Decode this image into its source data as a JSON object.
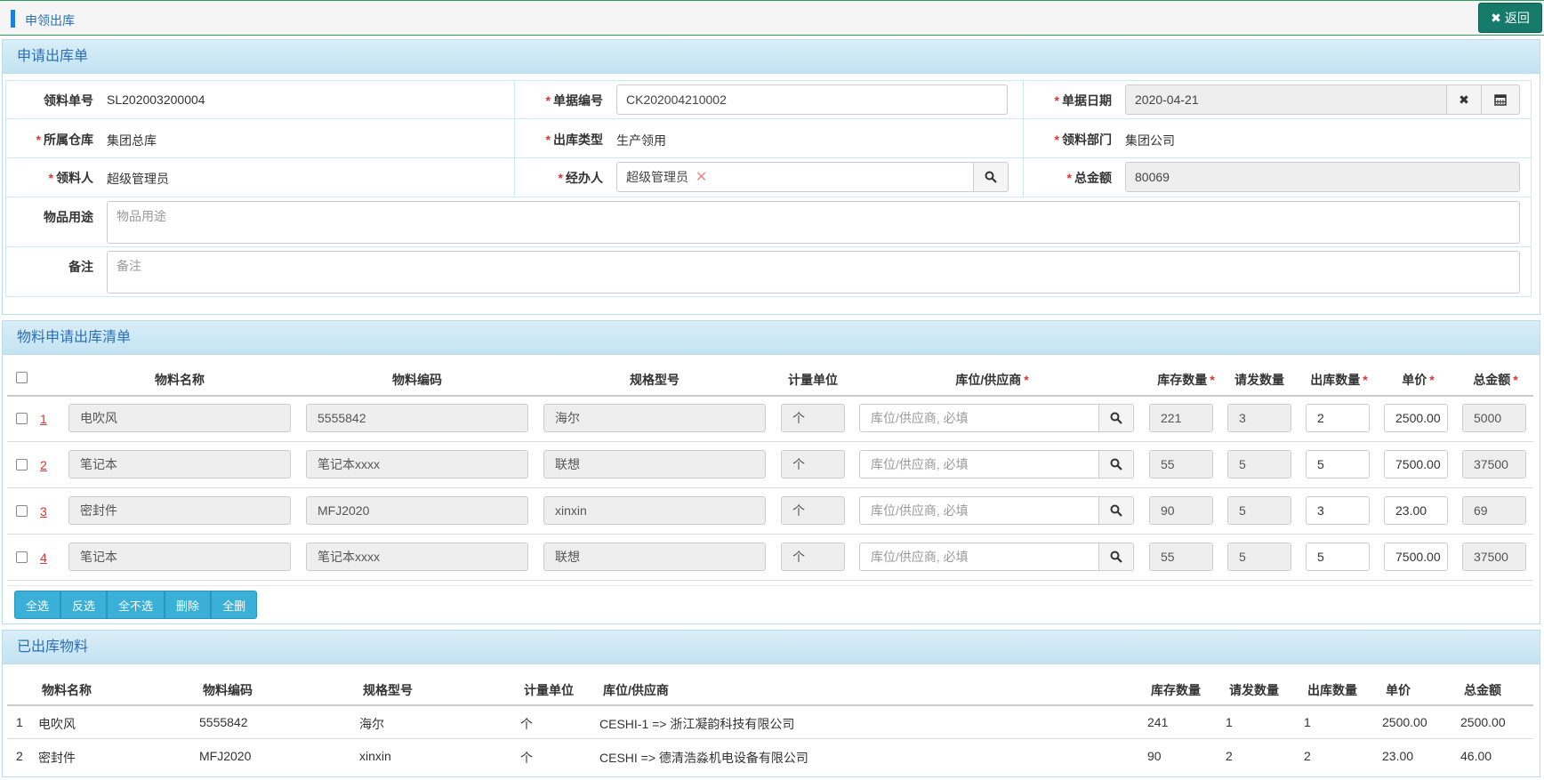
{
  "header": {
    "title": "申领出库",
    "back_label": "返回"
  },
  "form": {
    "title": "申请出库单",
    "fields": {
      "req_no_label": "领料单号",
      "req_no_value": "SL202003200004",
      "doc_no_label": "单据编号",
      "doc_no_value": "CK202004210002",
      "doc_date_label": "单据日期",
      "doc_date_value": "2020-04-21",
      "warehouse_label": "所属仓库",
      "warehouse_value": "集团总库",
      "out_type_label": "出库类型",
      "out_type_value": "生产领用",
      "dept_label": "领料部门",
      "dept_value": "集团公司",
      "picker_label": "领料人",
      "picker_value": "超级管理员",
      "handler_label": "经办人",
      "handler_value": "超级管理员",
      "total_label": "总金额",
      "total_value": "80069",
      "usage_label": "物品用途",
      "usage_placeholder": "物品用途",
      "remark_label": "备注",
      "remark_placeholder": "备注"
    }
  },
  "list": {
    "title": "物料申请出库清单",
    "columns": [
      "物料名称",
      "物料编码",
      "规格型号",
      "计量单位",
      "库位/供应商",
      "库存数量",
      "请发数量",
      "出库数量",
      "单价",
      "总金额"
    ],
    "location_placeholder": "库位/供应商, 必填",
    "rows": [
      {
        "num": "1",
        "name": "电吹风",
        "code": "5555842",
        "spec": "海尔",
        "unit": "个",
        "stock": "221",
        "req": "3",
        "out": "2",
        "price": "2500.00",
        "total": "5000"
      },
      {
        "num": "2",
        "name": "笔记本",
        "code": "笔记本xxxx",
        "spec": "联想",
        "unit": "个",
        "stock": "55",
        "req": "5",
        "out": "5",
        "price": "7500.00",
        "total": "37500"
      },
      {
        "num": "3",
        "name": "密封件",
        "code": "MFJ2020",
        "spec": "xinxin",
        "unit": "个",
        "stock": "90",
        "req": "5",
        "out": "3",
        "price": "23.00",
        "total": "69"
      },
      {
        "num": "4",
        "name": "笔记本",
        "code": "笔记本xxxx",
        "spec": "联想",
        "unit": "个",
        "stock": "55",
        "req": "5",
        "out": "5",
        "price": "7500.00",
        "total": "37500"
      }
    ],
    "actions": [
      "全选",
      "反选",
      "全不选",
      "删除",
      "全删"
    ]
  },
  "done": {
    "title": "已出库物料",
    "columns": [
      "物料名称",
      "物料编码",
      "规格型号",
      "计量单位",
      "库位/供应商",
      "库存数量",
      "请发数量",
      "出库数量",
      "单价",
      "总金额"
    ],
    "rows": [
      {
        "num": "1",
        "name": "电吹风",
        "code": "5555842",
        "spec": "海尔",
        "unit": "个",
        "location": "CESHI-1 => 浙江凝韵科技有限公司",
        "stock": "241",
        "req": "1",
        "out": "1",
        "price": "2500.00",
        "total": "2500.00"
      },
      {
        "num": "2",
        "name": "密封件",
        "code": "MFJ2020",
        "spec": "xinxin",
        "unit": "个",
        "location": "CESHI => 德清浩淼机电设备有限公司",
        "stock": "90",
        "req": "2",
        "out": "2",
        "price": "23.00",
        "total": "46.00"
      }
    ]
  }
}
